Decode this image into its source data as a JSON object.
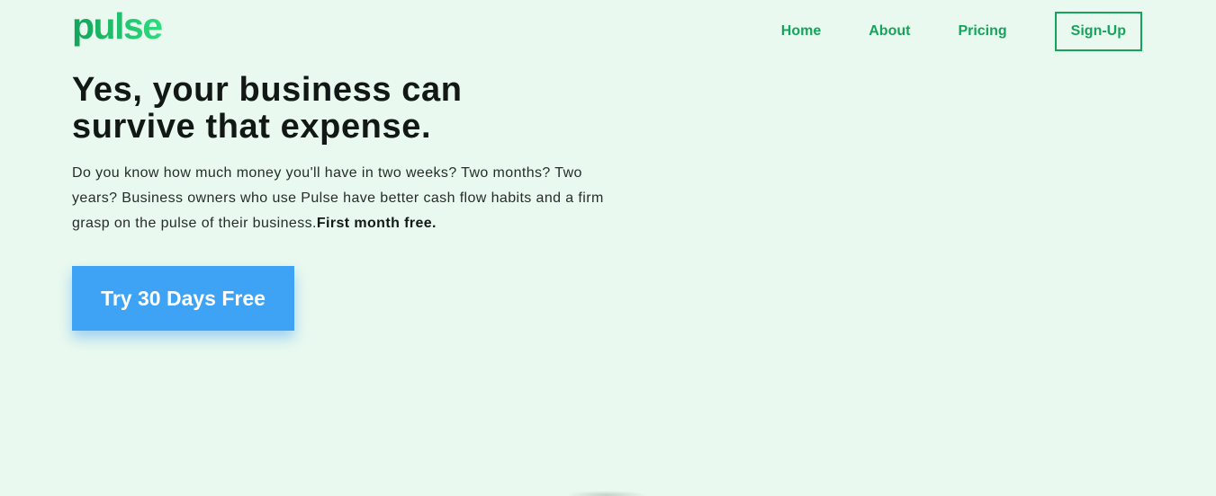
{
  "brand": {
    "name": "pulse",
    "colors": {
      "primary_green": "#16a35c",
      "light_green": "#28d97a",
      "background": "#e9f9ef",
      "cta_blue": "#3ea2f5"
    }
  },
  "nav": {
    "items": [
      {
        "label": "Home"
      },
      {
        "label": "About"
      },
      {
        "label": "Pricing"
      }
    ],
    "signup_label": "Sign-Up"
  },
  "hero": {
    "headline_line1": "Yes, your business can",
    "headline_line2": "survive that expense.",
    "body": "Do you know how much money you'll have in two weeks? Two months? Two years? Business owners who use Pulse have better cash flow habits and a firm grasp on the pulse of their business.",
    "body_emphasis": "First month free.",
    "cta_label": "Try 30 Days Free"
  }
}
